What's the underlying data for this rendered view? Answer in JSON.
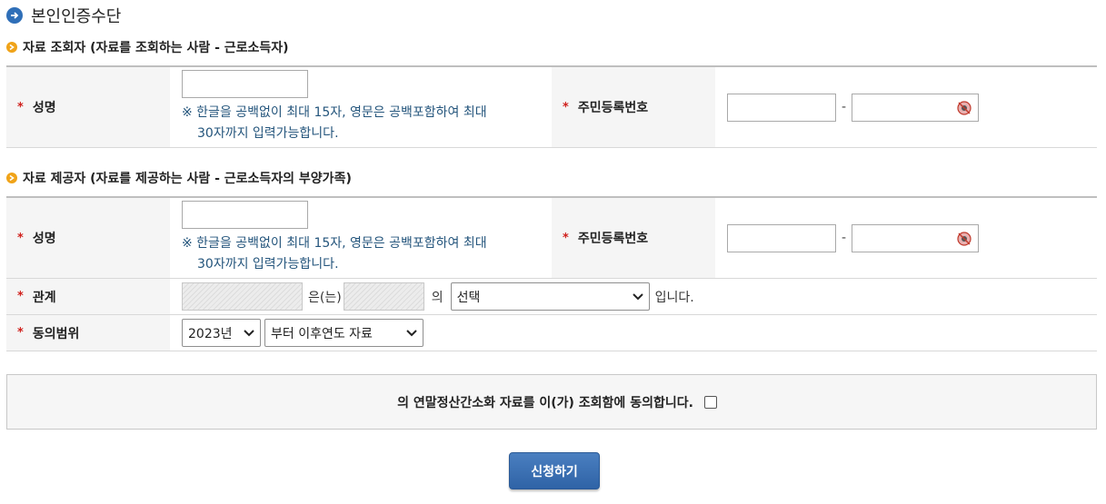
{
  "page": {
    "title": "본인인증수단"
  },
  "colors": {
    "accent": "#2f6fb8",
    "bullet": "#f0a318",
    "required": "#d0201c",
    "note": "#24557c",
    "button": "#2f63a6"
  },
  "viewer_section": {
    "title": "자료 조회자 (자료를 조회하는 사람 - 근로소득자)",
    "name_label": "성명",
    "name_value": "",
    "name_note_line1": "※ 한글을 공백없이 최대 15자, 영문은 공백포함하여 최대",
    "name_note_line2": "30자까지 입력가능합니다.",
    "ssn_label": "주민등록번호",
    "ssn_separator": "-"
  },
  "provider_section": {
    "title": "자료 제공자 (자료를 제공하는 사람 - 근로소득자의 부양가족)",
    "name_label": "성명",
    "name_value": "",
    "name_note_line1": "※ 한글을 공백없이 최대 15자, 영문은 공백포함하여 최대",
    "name_note_line2": "30자까지 입력가능합니다.",
    "ssn_label": "주민등록번호",
    "ssn_separator": "-",
    "relation_label": "관계",
    "relation_text1": "은(는)",
    "relation_text2": "의",
    "relation_select": "선택",
    "relation_text3": "입니다.",
    "scope_label": "동의범위",
    "scope_year": "2023년",
    "scope_range": "부터 이후연도 자료"
  },
  "agreement": {
    "text": "의 연말정산간소화 자료를 이(가) 조회함에 동의합니다.",
    "checked": false
  },
  "submit": {
    "label": "신청하기"
  },
  "icons": [
    "arrow-right-circle-icon",
    "bullet-icon",
    "eye-icon",
    "chevron-down-icon"
  ]
}
